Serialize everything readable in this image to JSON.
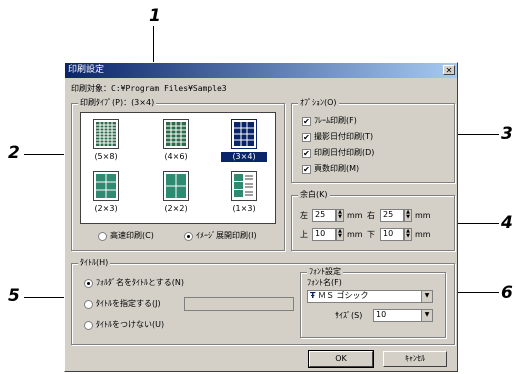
{
  "callouts": [
    "1",
    "2",
    "3",
    "4",
    "5",
    "6"
  ],
  "dialog": {
    "title": "印刷設定",
    "close_glyph": "✕",
    "target_label": "印刷対象：",
    "target_path": "C:¥Program Files¥Sample3"
  },
  "print_type": {
    "label": "印刷ﾀｲﾌﾟ(P)：(3×4)",
    "layouts": [
      {
        "caption": "(5×8)",
        "selected": false
      },
      {
        "caption": "(4×6)",
        "selected": false
      },
      {
        "caption": "(3×4)",
        "selected": true
      },
      {
        "caption": "(2×3)",
        "selected": false
      },
      {
        "caption": "(2×2)",
        "selected": false
      },
      {
        "caption": "(1×3)",
        "selected": false
      }
    ],
    "mode_fast": "高速印刷(C)",
    "mode_image": "ｲﾒｰｼﾞ展開印刷(I)",
    "selected_mode": "image"
  },
  "options": {
    "label": "ｵﾌﾟｼｮﾝ(O)",
    "items": [
      {
        "label": "ﾌﾚｰﾑ印刷(F)",
        "checked": true
      },
      {
        "label": "撮影日付印刷(T)",
        "checked": true
      },
      {
        "label": "印刷日付印刷(D)",
        "checked": true
      },
      {
        "label": "頁数印刷(M)",
        "checked": true
      }
    ],
    "check_glyph": "✔"
  },
  "margins": {
    "label": "余白(K)",
    "left_label": "左",
    "left_value": "25",
    "right_label": "右",
    "right_value": "25",
    "top_label": "上",
    "top_value": "10",
    "bottom_label": "下",
    "bottom_value": "10",
    "unit": "mm"
  },
  "title_group": {
    "label": "ﾀｲﾄﾙ(H)",
    "option_folder": "ﾌｫﾙﾀﾞ名をﾀｲﾄﾙとする(N)",
    "option_custom": "ﾀｲﾄﾙを指定する(J)",
    "option_none": "ﾀｲﾄﾙをつけない(U)",
    "custom_value": "",
    "selected": "folder"
  },
  "font": {
    "label": "ﾌｫﾝﾄ設定",
    "name_label": "ﾌｫﾝﾄ名(F)",
    "name_value": "ＭＳ ゴシック",
    "font_icon": "Ŧ",
    "size_label": "ｻｲｽﾞ(S)",
    "size_value": "10",
    "dropdown_glyph": "▼"
  },
  "buttons": {
    "ok": "OK",
    "cancel": "ｷｬﾝｾﾙ"
  },
  "spin_glyphs": {
    "up": "▲",
    "down": "▼"
  }
}
